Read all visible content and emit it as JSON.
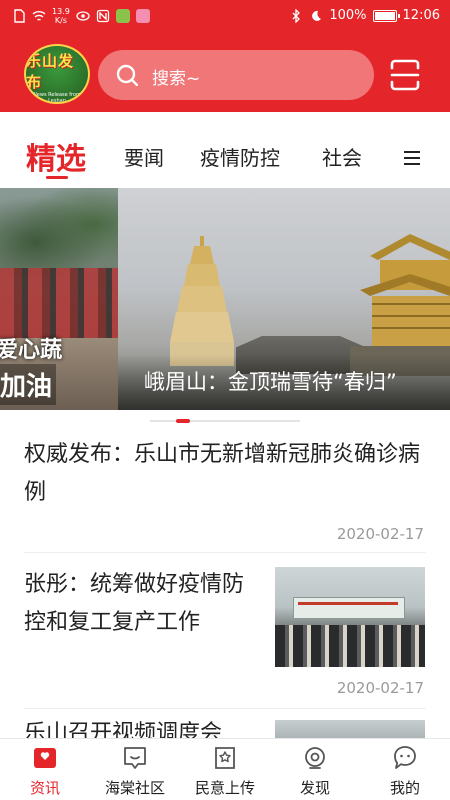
{
  "status_bar": {
    "speed_value": "13.9",
    "speed_unit": "K/s",
    "battery": "100%",
    "time": "12:06"
  },
  "header": {
    "logo_text": "乐山发布",
    "logo_subtext": "News Release from Leshan",
    "search_placeholder": "搜索~"
  },
  "tabs": [
    {
      "label": "精选",
      "active": true
    },
    {
      "label": "要闻"
    },
    {
      "label": "疫情防控"
    },
    {
      "label": "社会"
    }
  ],
  "banner": {
    "left_caption_line1": "爱心蔬",
    "left_caption_line2": "加油",
    "main_caption": "峨眉山：金顶瑞雪待“春归”"
  },
  "news": [
    {
      "title": "权威发布：乐山市无新增新冠肺炎确诊病例",
      "date": "2020-02-17"
    },
    {
      "title": "张彤：统筹做好疫情防控和复工复产工作",
      "date": "2020-02-17"
    },
    {
      "title": "乐山召开视频调度会"
    }
  ],
  "bottom_nav": [
    {
      "label": "资讯",
      "icon": "news-icon",
      "active": true
    },
    {
      "label": "海棠社区",
      "icon": "community-icon"
    },
    {
      "label": "民意上传",
      "icon": "upload-opinion-icon"
    },
    {
      "label": "发现",
      "icon": "discover-icon"
    },
    {
      "label": "我的",
      "icon": "profile-icon"
    }
  ],
  "colors": {
    "brand_red": "#e4262a",
    "search_bg": "#f07678",
    "date_gray": "#9a9a9a"
  }
}
